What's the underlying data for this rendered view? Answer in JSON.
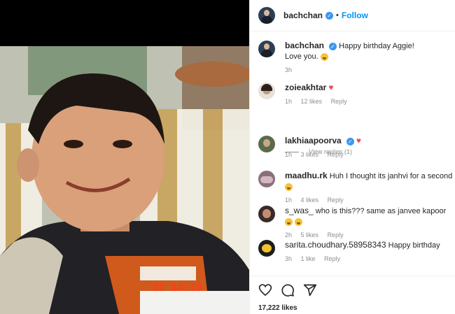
{
  "post": {
    "username": "bachchan",
    "follow_label": "Follow",
    "dot": "•",
    "timestamp_stamp": "27 14:19"
  },
  "caption": {
    "username": "bachchan",
    "text_line1": "Happy birthday Aggie!",
    "text_line2": "Love you.",
    "time": "3h"
  },
  "comments": [
    {
      "username": "zoieakhtar",
      "text": "",
      "time": "1h",
      "likes": "12 likes",
      "reply": "Reply",
      "avatar_color": "#e8e1d9"
    },
    {
      "username": "lakhiaapoorva",
      "text": "",
      "time": "1h",
      "likes": "3 likes",
      "reply": "Reply",
      "avatar_color": "#5b6b4a"
    },
    {
      "username": "maadhu.rk",
      "text": "Huh I thought its janhvi for a second",
      "time": "1h",
      "likes": "4 likes",
      "reply": "Reply",
      "avatar_color": "#8a6f7c"
    },
    {
      "username": "s_was_",
      "text": "who is this??? same as janvee kapoor",
      "time": "2h",
      "likes": "5 likes",
      "reply": "Reply",
      "avatar_color": "#3a2a2a"
    },
    {
      "username": "sarita.choudhary.58958343",
      "text": "Happy birthday",
      "time": "3h",
      "likes": "1 like",
      "reply": "Reply",
      "avatar_color": "#1d1d1d"
    }
  ],
  "view_replies": "View replies (1)",
  "likes_count": "17,222 likes",
  "icons": {
    "like": "heart-icon",
    "comment": "comment-icon",
    "share": "share-icon",
    "verified": "verified-badge-icon",
    "emoji": "emoji-icon"
  },
  "colors": {
    "accent": "#0095f6",
    "verified": "#3897f0",
    "heart": "#ed4956",
    "stamp": "#ff3a1f"
  }
}
